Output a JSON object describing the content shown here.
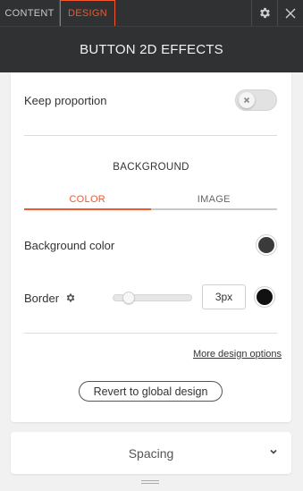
{
  "tabs": {
    "content": "CONTENT",
    "design": "DESIGN"
  },
  "icons": {
    "settings": "gear-icon",
    "close": "close-icon"
  },
  "header": {
    "title": "BUTTON 2D EFFECTS"
  },
  "keep_proportion": {
    "label": "Keep proportion",
    "enabled": false
  },
  "background": {
    "section_title": "BACKGROUND",
    "subtabs": {
      "color": "COLOR",
      "image": "IMAGE",
      "active": "COLOR"
    },
    "color_label": "Background color",
    "color_value": "#3a3a3a"
  },
  "border": {
    "label": "Border",
    "width_value": "3px",
    "slider_fraction": 0.13,
    "color_value": "#111111"
  },
  "links": {
    "more_design_options": "More design options"
  },
  "buttons": {
    "revert": "Revert to global design"
  },
  "spacing": {
    "label": "Spacing"
  },
  "colors": {
    "accent": "#f1582d",
    "dark_bar": "#2f3132"
  }
}
